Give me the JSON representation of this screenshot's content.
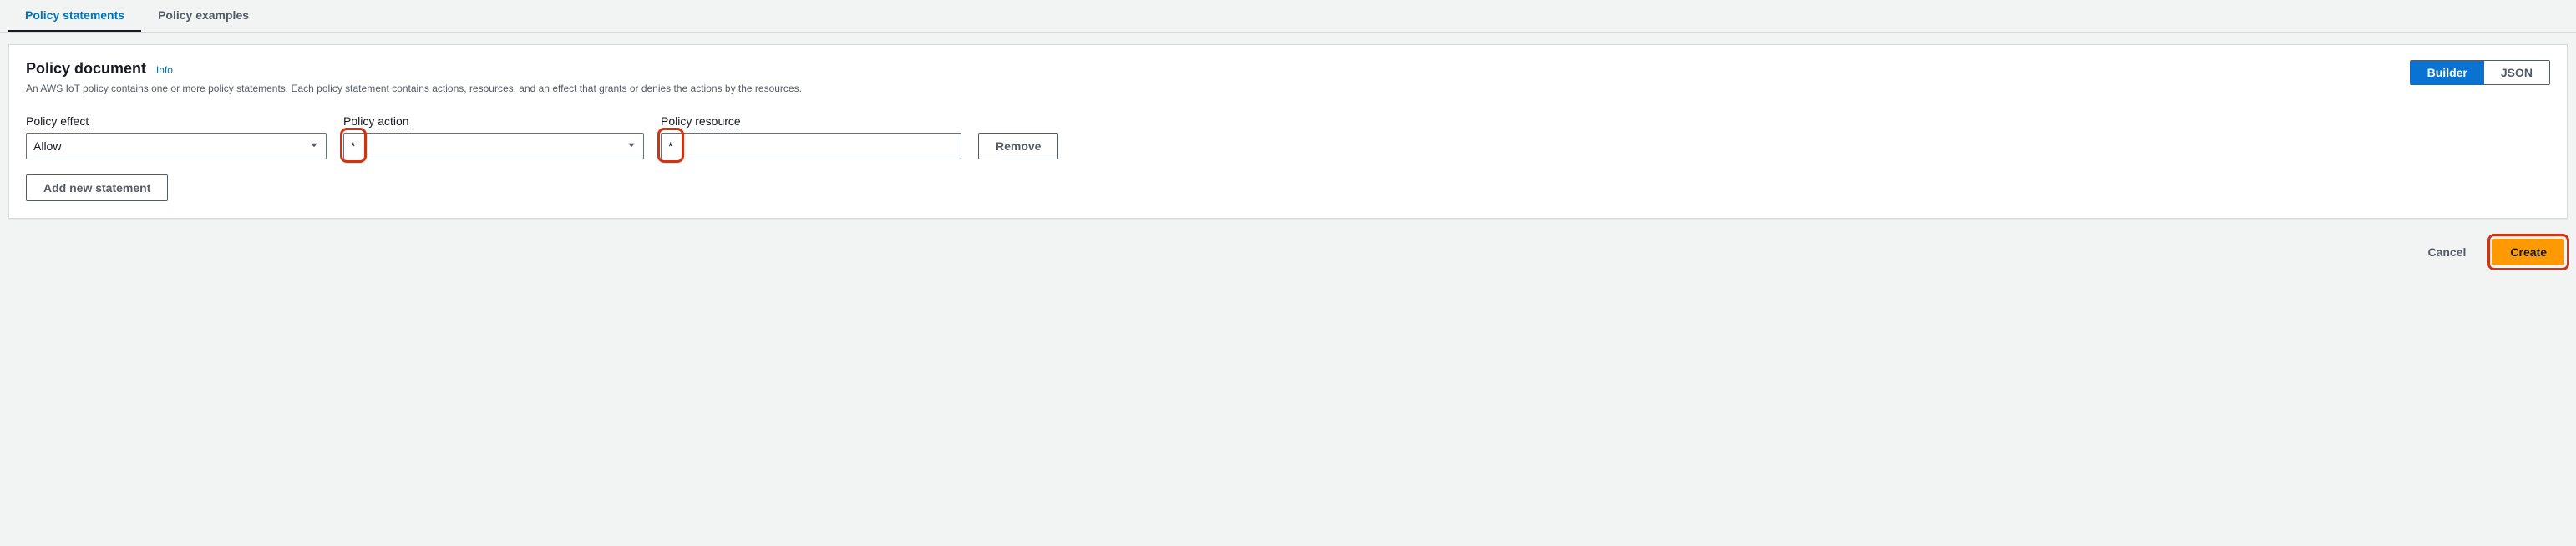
{
  "tabs": {
    "statements": "Policy statements",
    "examples": "Policy examples"
  },
  "panel": {
    "title": "Policy document",
    "info": "Info",
    "description": "An AWS IoT policy contains one or more policy statements. Each policy statement contains actions, resources, and an effect that grants or denies the actions by the resources."
  },
  "toggle": {
    "builder": "Builder",
    "json": "JSON"
  },
  "fields": {
    "effect": {
      "label": "Policy effect",
      "value": "Allow"
    },
    "action": {
      "label": "Policy action",
      "value": "*"
    },
    "resource": {
      "label": "Policy resource",
      "value": "*"
    }
  },
  "buttons": {
    "remove": "Remove",
    "add": "Add new statement",
    "cancel": "Cancel",
    "create": "Create"
  }
}
